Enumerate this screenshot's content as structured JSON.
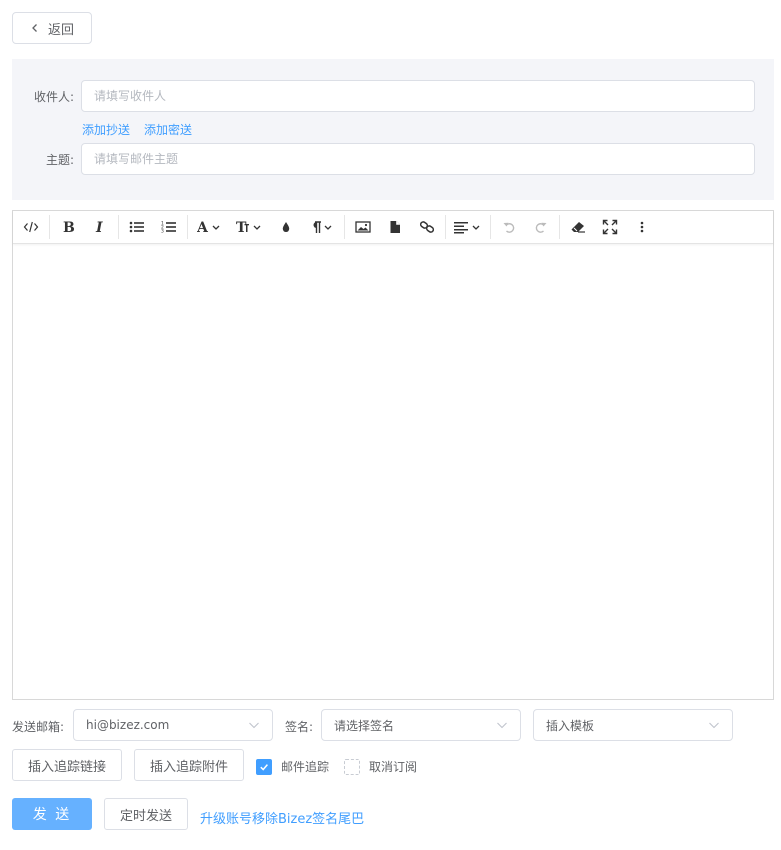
{
  "back_button": {
    "label": "返回"
  },
  "recipient": {
    "label": "收件人:",
    "placeholder": "请填写收件人"
  },
  "cc_links": {
    "add_cc": "添加抄送",
    "add_bcc": "添加密送"
  },
  "subject": {
    "label": "主题:",
    "placeholder": "请填写邮件主题"
  },
  "toolbar": {
    "buttons": [
      "code-view",
      "bold",
      "italic",
      "bulleted-list",
      "numbered-list",
      "font-family",
      "font-size",
      "text-color",
      "paragraph-format",
      "insert-image",
      "insert-file",
      "insert-link",
      "align",
      "undo",
      "redo",
      "clear-formatting",
      "fullscreen",
      "more"
    ],
    "disabled": [
      "undo",
      "redo"
    ]
  },
  "sender": {
    "label": "发送邮箱:",
    "value": "hi@bizez.com"
  },
  "signature": {
    "label": "签名:",
    "value": "请选择签名"
  },
  "template": {
    "value": "插入模板"
  },
  "actions": {
    "insert_tracking_link": "插入追踪链接",
    "insert_tracking_attachment": "插入追踪附件",
    "mail_tracking": {
      "label": "邮件追踪",
      "checked": true
    },
    "unsubscribe": {
      "label": "取消订阅",
      "checked": false
    },
    "send": "发 送",
    "schedule_send": "定时发送",
    "upgrade_link": "升级账号移除Bizez签名尾巴"
  },
  "colors": {
    "primary": "#409eff",
    "primary_light": "#66b1ff",
    "panel_bg": "#f4f5f9",
    "border": "#dcdfe6"
  }
}
